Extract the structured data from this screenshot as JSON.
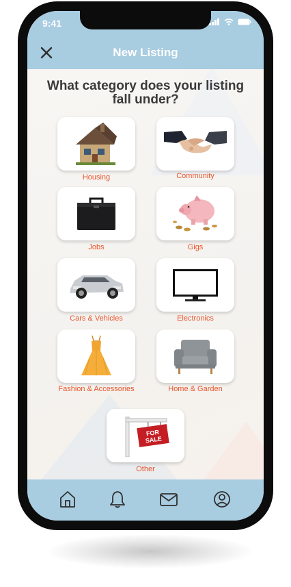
{
  "status_bar": {
    "time": "9:41"
  },
  "header": {
    "title": "New Listing"
  },
  "prompt": {
    "question": "What category does your listing fall under?"
  },
  "categories": [
    {
      "label": "Housing"
    },
    {
      "label": "Community"
    },
    {
      "label": "Jobs"
    },
    {
      "label": "Gigs"
    },
    {
      "label": "Cars & Vehicles"
    },
    {
      "label": "Electronics"
    },
    {
      "label": "Fashion & Accessories"
    },
    {
      "label": "Home & Garden"
    },
    {
      "label": "Other"
    }
  ],
  "colors": {
    "header": "#a8cce0",
    "label": "#e8542a",
    "question": "#3a3a3a"
  },
  "icons": [
    "close-icon",
    "home-icon",
    "bell-icon",
    "mail-icon",
    "profile-icon"
  ],
  "for_sale_sign": "FOR SALE"
}
